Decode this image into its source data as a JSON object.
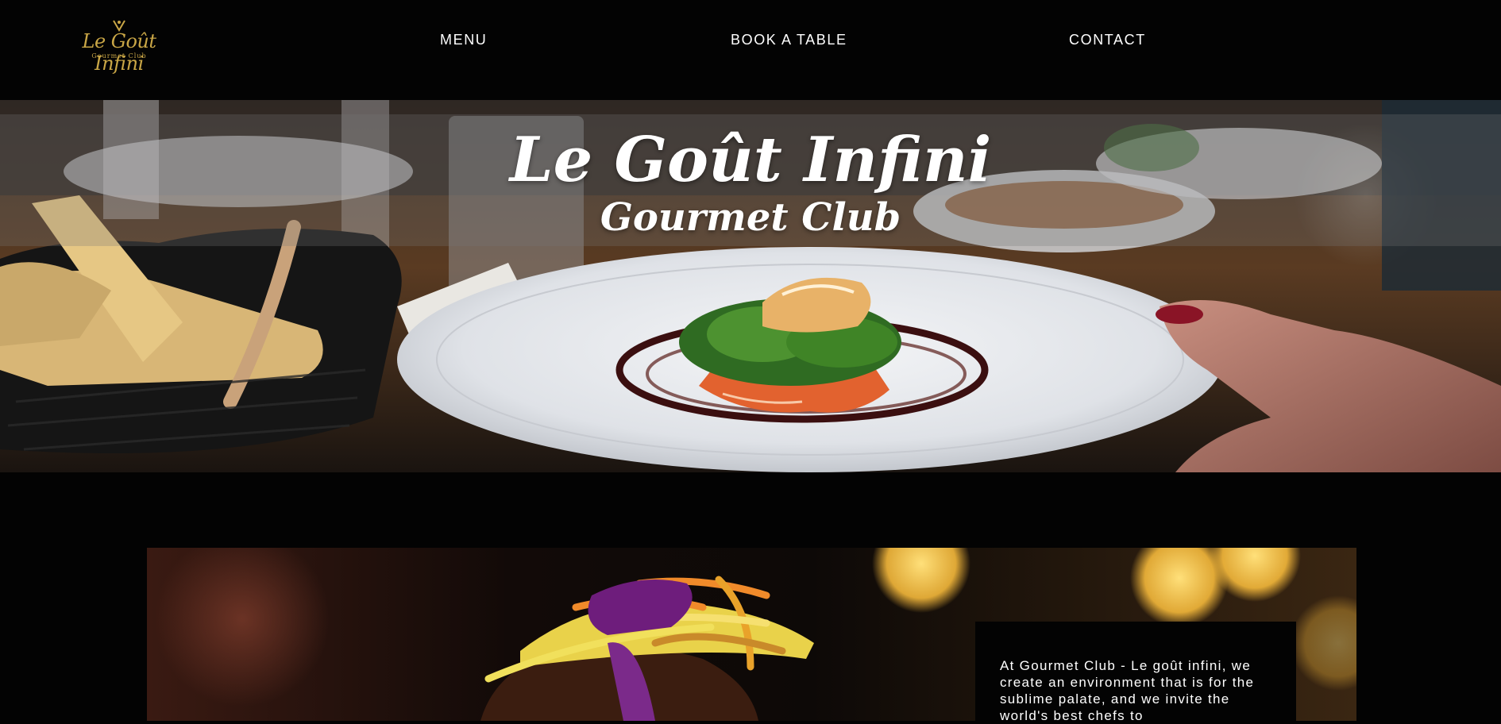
{
  "brand": {
    "logo_title": "Le Goût Infini",
    "logo_subtitle": "Gourmet Club",
    "accent_color": "#c9a646"
  },
  "nav": {
    "items": [
      {
        "label": "MENU"
      },
      {
        "label": "BOOK A TABLE"
      },
      {
        "label": "CONTACT"
      }
    ]
  },
  "hero": {
    "title": "Le Goût Infini",
    "subtitle": "Gourmet Club",
    "image_icon": "plated-dish-photo"
  },
  "about": {
    "text": "At Gourmet Club - Le goût infini, we create an environment that is for the sublime palate, and we invite the world's best chefs to",
    "image_icon": "gourmet-burger-photo"
  }
}
